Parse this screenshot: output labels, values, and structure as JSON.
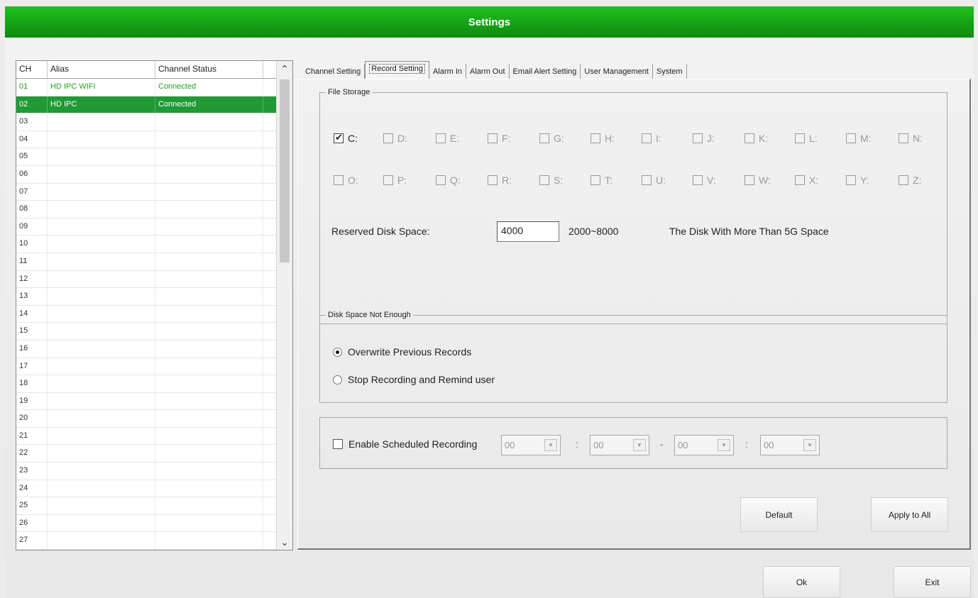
{
  "window": {
    "title": "Settings"
  },
  "channel_list": {
    "headers": {
      "ch": "CH",
      "alias": "Alias",
      "status": "Channel Status"
    },
    "rows": [
      {
        "ch": "01",
        "alias": "HD IPC WIFI",
        "status": "Connected"
      },
      {
        "ch": "02",
        "alias": "HD IPC",
        "status": "Connected"
      },
      {
        "ch": "03",
        "alias": "",
        "status": ""
      },
      {
        "ch": "04",
        "alias": "",
        "status": ""
      },
      {
        "ch": "05",
        "alias": "",
        "status": ""
      },
      {
        "ch": "06",
        "alias": "",
        "status": ""
      },
      {
        "ch": "07",
        "alias": "",
        "status": ""
      },
      {
        "ch": "08",
        "alias": "",
        "status": ""
      },
      {
        "ch": "09",
        "alias": "",
        "status": ""
      },
      {
        "ch": "10",
        "alias": "",
        "status": ""
      },
      {
        "ch": "11",
        "alias": "",
        "status": ""
      },
      {
        "ch": "12",
        "alias": "",
        "status": ""
      },
      {
        "ch": "13",
        "alias": "",
        "status": ""
      },
      {
        "ch": "14",
        "alias": "",
        "status": ""
      },
      {
        "ch": "15",
        "alias": "",
        "status": ""
      },
      {
        "ch": "16",
        "alias": "",
        "status": ""
      },
      {
        "ch": "17",
        "alias": "",
        "status": ""
      },
      {
        "ch": "18",
        "alias": "",
        "status": ""
      },
      {
        "ch": "19",
        "alias": "",
        "status": ""
      },
      {
        "ch": "20",
        "alias": "",
        "status": ""
      },
      {
        "ch": "21",
        "alias": "",
        "status": ""
      },
      {
        "ch": "22",
        "alias": "",
        "status": ""
      },
      {
        "ch": "23",
        "alias": "",
        "status": ""
      },
      {
        "ch": "24",
        "alias": "",
        "status": ""
      },
      {
        "ch": "25",
        "alias": "",
        "status": ""
      },
      {
        "ch": "26",
        "alias": "",
        "status": ""
      },
      {
        "ch": "27",
        "alias": "",
        "status": ""
      }
    ],
    "selected_ch": "02",
    "scroll_up_icon": "chevron-up-icon",
    "scroll_down_icon": "chevron-down-icon"
  },
  "tabs": [
    {
      "label": "Channel Setting",
      "active": false
    },
    {
      "label": "Record Setting",
      "active": true
    },
    {
      "label": "Alarm In",
      "active": false
    },
    {
      "label": "Alarm Out",
      "active": false
    },
    {
      "label": "Email Alert Setting",
      "active": false
    },
    {
      "label": "User Management",
      "active": false
    },
    {
      "label": "System",
      "active": false
    }
  ],
  "file_storage": {
    "legend": "File Storage",
    "drives": [
      {
        "label": "C:",
        "checked": true,
        "enabled": true
      },
      {
        "label": "D:",
        "checked": false,
        "enabled": false
      },
      {
        "label": "E:",
        "checked": false,
        "enabled": false
      },
      {
        "label": "F:",
        "checked": false,
        "enabled": false
      },
      {
        "label": "G:",
        "checked": false,
        "enabled": false
      },
      {
        "label": "H:",
        "checked": false,
        "enabled": false
      },
      {
        "label": "I:",
        "checked": false,
        "enabled": false
      },
      {
        "label": "J:",
        "checked": false,
        "enabled": false
      },
      {
        "label": "K:",
        "checked": false,
        "enabled": false
      },
      {
        "label": "L:",
        "checked": false,
        "enabled": false
      },
      {
        "label": "M:",
        "checked": false,
        "enabled": false
      },
      {
        "label": "N:",
        "checked": false,
        "enabled": false
      },
      {
        "label": "O:",
        "checked": false,
        "enabled": false
      },
      {
        "label": "P:",
        "checked": false,
        "enabled": false
      },
      {
        "label": "Q:",
        "checked": false,
        "enabled": false
      },
      {
        "label": "R:",
        "checked": false,
        "enabled": false
      },
      {
        "label": "S:",
        "checked": false,
        "enabled": false
      },
      {
        "label": "T:",
        "checked": false,
        "enabled": false
      },
      {
        "label": "U:",
        "checked": false,
        "enabled": false
      },
      {
        "label": "V:",
        "checked": false,
        "enabled": false
      },
      {
        "label": "W:",
        "checked": false,
        "enabled": false
      },
      {
        "label": "X:",
        "checked": false,
        "enabled": false
      },
      {
        "label": "Y:",
        "checked": false,
        "enabled": false
      },
      {
        "label": "Z:",
        "checked": false,
        "enabled": false
      }
    ],
    "reserved_label": "Reserved Disk Space:",
    "reserved_value": "4000",
    "range_text": "2000~8000",
    "hint_text": "The Disk With More Than 5G Space"
  },
  "disk_space": {
    "legend": "Disk Space Not Enough",
    "options": [
      {
        "label": "Overwrite Previous Records",
        "selected": true
      },
      {
        "label": "Stop Recording and Remind user",
        "selected": false
      }
    ]
  },
  "schedule": {
    "enable_label": "Enable Scheduled Recording",
    "enabled": false,
    "start_hour": "00",
    "start_min": "00",
    "end_hour": "00",
    "end_min": "00",
    "sep_colon": ":",
    "sep_dash": "-"
  },
  "buttons": {
    "default": "Default",
    "apply_all": "Apply to All",
    "ok": "Ok",
    "exit": "Exit"
  },
  "colors": {
    "title_green": "#17a817",
    "selected_row": "#1f9a35",
    "connected_text": "#22a022"
  }
}
